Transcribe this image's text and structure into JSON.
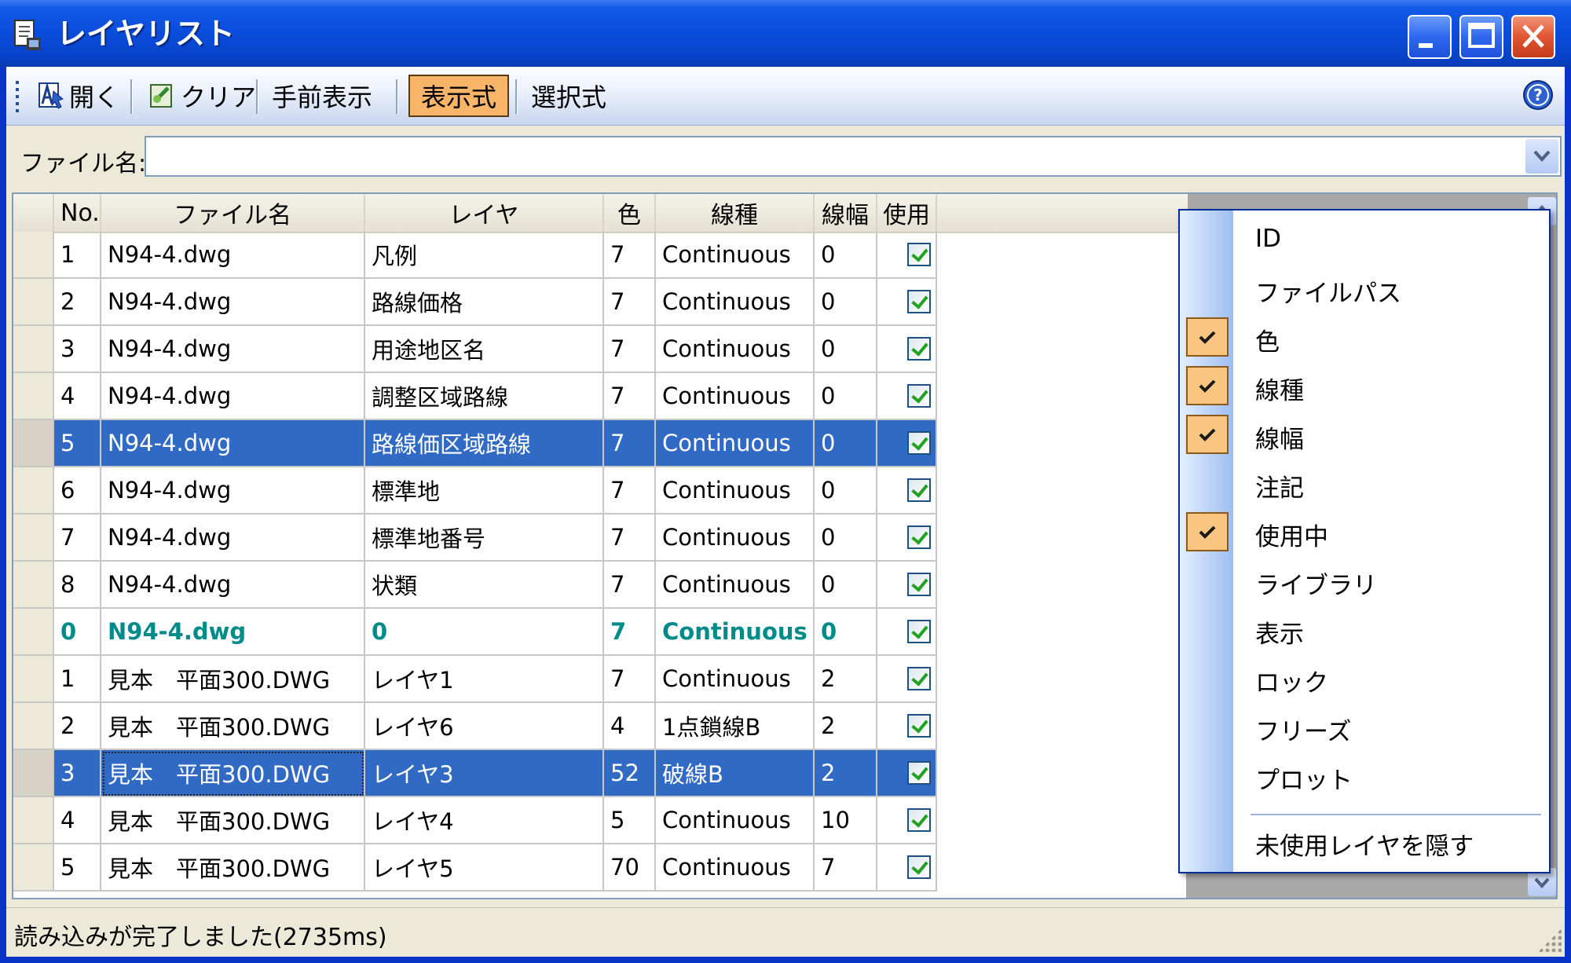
{
  "window": {
    "title": "レイヤリスト"
  },
  "toolbar": {
    "open_label": "開く",
    "clear_label": "クリア",
    "front_label": "手前表示",
    "expr_label": "表示式",
    "select_label": "選択式"
  },
  "filebar": {
    "label": "ファイル名:",
    "value": ""
  },
  "grid": {
    "columns": [
      "No.",
      "ファイル名",
      "レイヤ",
      "色",
      "線種",
      "線幅",
      "使用"
    ],
    "rows": [
      {
        "no": "1",
        "file": "N94-4.dwg",
        "layer": "凡例",
        "color": "7",
        "linetype": "Continuous",
        "width": "0",
        "used": true
      },
      {
        "no": "2",
        "file": "N94-4.dwg",
        "layer": "路線価格",
        "color": "7",
        "linetype": "Continuous",
        "width": "0",
        "used": true
      },
      {
        "no": "3",
        "file": "N94-4.dwg",
        "layer": "用途地区名",
        "color": "7",
        "linetype": "Continuous",
        "width": "0",
        "used": true
      },
      {
        "no": "4",
        "file": "N94-4.dwg",
        "layer": "調整区域路線",
        "color": "7",
        "linetype": "Continuous",
        "width": "0",
        "used": true
      },
      {
        "no": "5",
        "file": "N94-4.dwg",
        "layer": "路線価区域路線",
        "color": "7",
        "linetype": "Continuous",
        "width": "0",
        "used": true
      },
      {
        "no": "6",
        "file": "N94-4.dwg",
        "layer": "標準地",
        "color": "7",
        "linetype": "Continuous",
        "width": "0",
        "used": true
      },
      {
        "no": "7",
        "file": "N94-4.dwg",
        "layer": "標準地番号",
        "color": "7",
        "linetype": "Continuous",
        "width": "0",
        "used": true
      },
      {
        "no": "8",
        "file": "N94-4.dwg",
        "layer": "状類",
        "color": "7",
        "linetype": "Continuous",
        "width": "0",
        "used": true
      },
      {
        "no": "0",
        "file": "N94-4.dwg",
        "layer": "0",
        "color": "7",
        "linetype": "Continuous",
        "width": "0",
        "used": true
      },
      {
        "no": "1",
        "file": "見本　平面300.DWG",
        "layer": "レイヤ1",
        "color": "7",
        "linetype": "Continuous",
        "width": "2",
        "used": true
      },
      {
        "no": "2",
        "file": "見本　平面300.DWG",
        "layer": "レイヤ6",
        "color": "4",
        "linetype": "1点鎖線B",
        "width": "2",
        "used": true
      },
      {
        "no": "3",
        "file": "見本　平面300.DWG",
        "layer": "レイヤ3",
        "color": "52",
        "linetype": "破線B",
        "width": "2",
        "used": true
      },
      {
        "no": "4",
        "file": "見本　平面300.DWG",
        "layer": "レイヤ4",
        "color": "5",
        "linetype": "Continuous",
        "width": "10",
        "used": true
      },
      {
        "no": "5",
        "file": "見本　平面300.DWG",
        "layer": "レイヤ5",
        "color": "70",
        "linetype": "Continuous",
        "width": "7",
        "used": true
      }
    ]
  },
  "context_menu": {
    "items": [
      {
        "label": "ID",
        "checked": false
      },
      {
        "label": "ファイルパス",
        "checked": false
      },
      {
        "label": "色",
        "checked": true
      },
      {
        "label": "線種",
        "checked": true
      },
      {
        "label": "線幅",
        "checked": true
      },
      {
        "label": "注記",
        "checked": false
      },
      {
        "label": "使用中",
        "checked": true
      },
      {
        "label": "ライブラリ",
        "checked": false
      },
      {
        "label": "表示",
        "checked": false
      },
      {
        "label": "ロック",
        "checked": false
      },
      {
        "label": "フリーズ",
        "checked": false
      },
      {
        "label": "プロット",
        "checked": false
      }
    ],
    "hide_unused_label": "未使用レイヤを隠す"
  },
  "status": {
    "text": "読み込みが完了しました(2735ms)"
  },
  "colors": {
    "selection": "#316AC5",
    "highlight_row_text": "#008B8B",
    "active_button": "#F8B56A",
    "title_bar": "#0A4CDB"
  }
}
